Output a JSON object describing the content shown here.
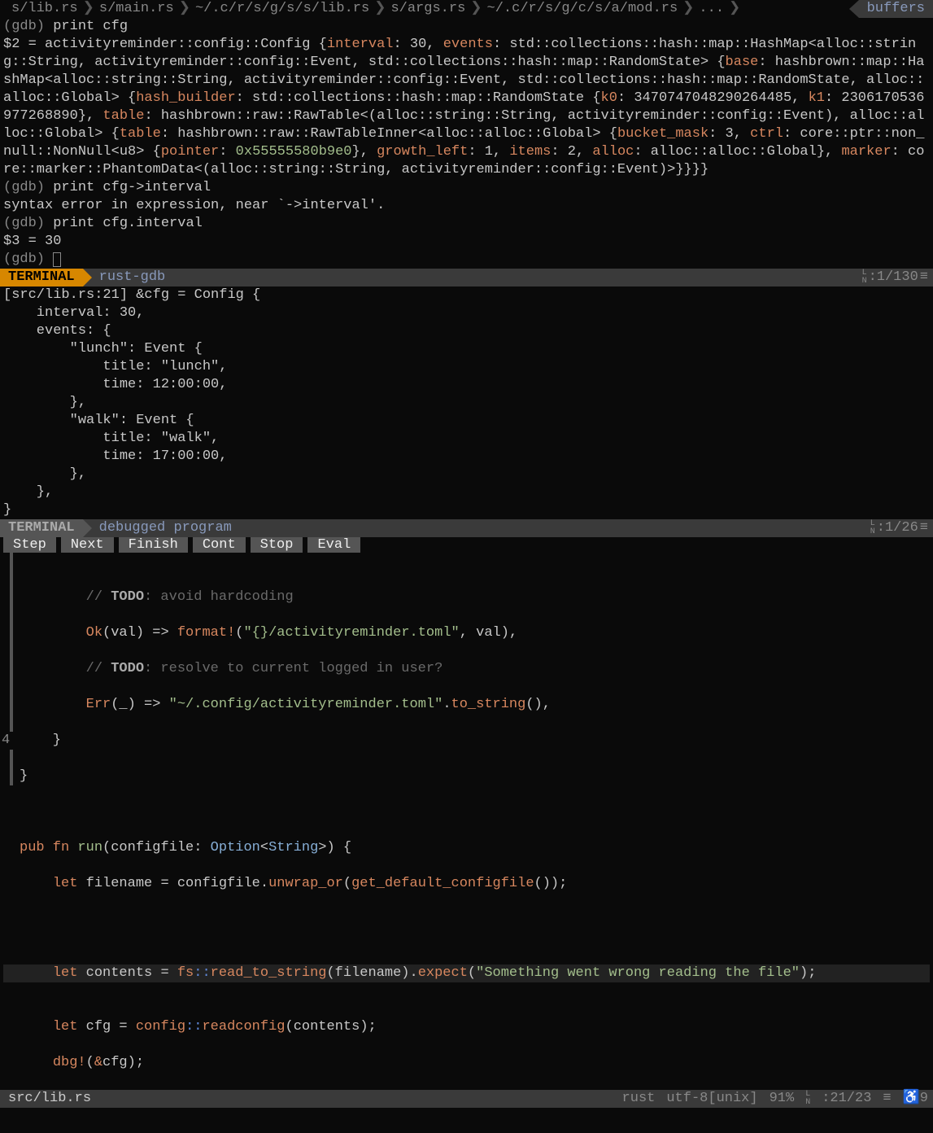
{
  "tabs": [
    "s/lib.rs",
    "s/main.rs",
    "~/.c/r/s/g/s/s/lib.rs",
    "s/args.rs",
    "~/.c/r/s/g/c/s/a/mod.rs",
    "..."
  ],
  "buffers_label": "buffers",
  "gdb": {
    "l1_prompt": "(gdb) ",
    "l1_cmd": "print cfg",
    "l2": "$2 = activityreminder::config::Config {",
    "interval_k": "interval",
    "interval_v": ": 30, ",
    "events_k": "events",
    "events_v": ": std::collections::hash::map::HashMap<alloc::string::String, activityreminder::config::Event, std::collections::hash::map::RandomState> {",
    "base_k": "base",
    "base_v": ": hashbrown::map::HashMap<alloc::string::String, activityreminder::config::Event, std::collections::hash::map::RandomState, alloc::alloc::Global> {",
    "hash_builder_k": "hash_builder",
    "hash_builder_v": ": std::collections::hash::map::RandomState {",
    "k0_k": "k0",
    "k0_v": ": 3470747048290264485, ",
    "k1_k": "k1",
    "k1_v": ": 2306170536977268890}, ",
    "table_k": "table",
    "table_v": ": hashbrown::raw::RawTable<(alloc::string::String, activityreminder::config::Event), alloc::alloc::Global> {",
    "table2_k": "table",
    "table2_v": ": hashbrown::raw::RawTableInner<alloc::alloc::Global> {",
    "bucket_mask_k": "bucket_mask",
    "bucket_mask_v": ": 3, ",
    "ctrl_k": "ctrl",
    "ctrl_v": ": core::ptr::non_null::NonNull<u8> {",
    "pointer_k": "pointer",
    "pointer_v": ": ",
    "pointer_addr": "0x55555580b9e0",
    "pointer_close": "}, ",
    "growth_left_k": "growth_left",
    "growth_left_v": ": 1, ",
    "items_k": "items",
    "items_v": ": 2, ",
    "alloc_k": "alloc",
    "alloc_v": ": alloc::alloc::Global}, ",
    "marker_k": "marker",
    "marker_v": ": core::marker::PhantomData<(alloc::string::String, activityreminder::config::Event)>}}}}",
    "l3_prompt": "(gdb) ",
    "l3_cmd": "print cfg->interval",
    "l4": "syntax error in expression, near `->interval'.",
    "l5_prompt": "(gdb) ",
    "l5_cmd": "print cfg.interval",
    "l6": "$3 = 30",
    "l7_prompt": "(gdb) "
  },
  "term1": {
    "mode": "TERMINAL",
    "title": "rust-gdb",
    "pos": ":1/130"
  },
  "dbg_out": "[src/lib.rs:21] &cfg = Config {\n    interval: 30,\n    events: {\n        \"lunch\": Event {\n            title: \"lunch\",\n            time: 12:00:00,\n        },\n        \"walk\": Event {\n            title: \"walk\",\n            time: 17:00:00,\n        },\n    },\n}",
  "term2": {
    "mode": "TERMINAL",
    "title": "debugged program",
    "pos": ":1/26"
  },
  "buttons": [
    "Step",
    "Next",
    "Finish",
    "Cont",
    "Stop",
    "Eval"
  ],
  "code": {
    "c1a": "        // ",
    "c1b": "TODO",
    "c1c": ": avoid hardcoding",
    "c2a": "        ",
    "c2_ok": "Ok",
    "c2b": "(val) => ",
    "c2_fmt": "format!",
    "c2c": "(",
    "c2_str": "\"{}/activityreminder.toml\"",
    "c2d": ", val),",
    "c3a": "        // ",
    "c3b": "TODO",
    "c3c": ": resolve to current logged in user?",
    "c4a": "        ",
    "c4_err": "Err",
    "c4b": "(_) => ",
    "c4_str": "\"~/.config/activityreminder.toml\"",
    "c4c": ".",
    "c4_fn": "to_string",
    "c4d": "(),",
    "c5": "    }",
    "c6": "}",
    "c7": "",
    "c8a": "pub",
    "c8b": " fn",
    "c8c": " run",
    "c8d": "(configfile: ",
    "c8_opt": "Option",
    "c8e": "<",
    "c8_str": "String",
    "c8f": ">) {",
    "c9a": "    ",
    "c9_let": "let",
    "c9b": " filename = configfile.",
    "c9_fn": "unwrap_or",
    "c9c": "(",
    "c9_fn2": "get_default_configfile",
    "c9d": "());",
    "c10": "",
    "c11_mark": "4",
    "c11a": "    ",
    "c11_let": "let",
    "c11b": " contents = ",
    "c11_fs": "fs",
    "c11_cc": "::",
    "c11_fn": "read_to_string",
    "c11c": "(filename).",
    "c11_exp": "expect",
    "c11d": "(",
    "c11_str": "\"Something went wrong reading the file\"",
    "c11e": ");",
    "c12a": "    ",
    "c12_let": "let",
    "c12b": " cfg = ",
    "c12_cfg": "config",
    "c12_cc": "::",
    "c12_fn": "readconfig",
    "c12c": "(contents);",
    "c13a": "    ",
    "c13_dbg": "dbg!",
    "c13b": "(",
    "c13_amp": "&",
    "c13c": "cfg);"
  },
  "bottom": {
    "file": "src/lib.rs",
    "lang": "rust",
    "enc": "utf-8[unix]",
    "pct": "91%",
    "pos": ":21/23",
    "col": "9"
  }
}
